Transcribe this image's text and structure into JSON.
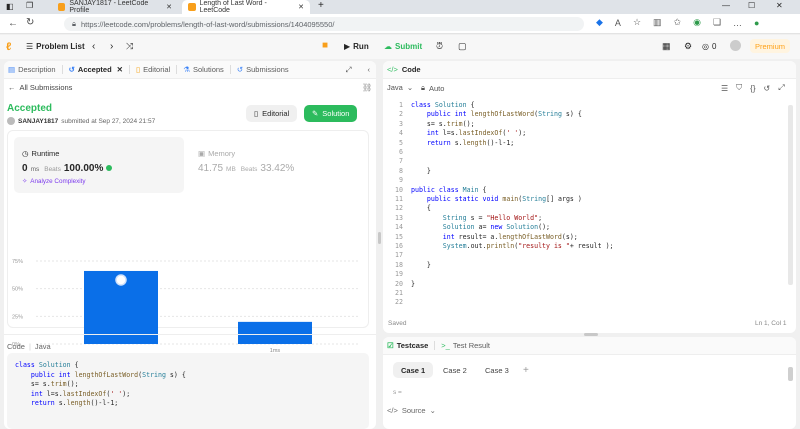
{
  "browser": {
    "tabs": [
      {
        "title": "SANJAY1817 - LeetCode Profile"
      },
      {
        "title": "Length of Last Word - LeetCode"
      }
    ],
    "url": "https://leetcode.com/problems/length-of-last-word/submissions/1404095550/"
  },
  "header": {
    "problem_list": "Problem List",
    "run": "Run",
    "submit": "Submit",
    "coins": "0",
    "premium": "Premium"
  },
  "left": {
    "tabs": [
      "Description",
      "Accepted",
      "Editorial",
      "Solutions",
      "Submissions"
    ],
    "back": "All Submissions",
    "status": "Accepted",
    "user": "SANJAY1817",
    "submitted": "submitted at Sep 27, 2024 21:57",
    "editorial_btn": "Editorial",
    "solution_btn": "Solution",
    "runtime": {
      "label": "Runtime",
      "value": "0",
      "unit": "ms",
      "beats_label": "Beats",
      "beats": "100.00%",
      "analyze": "Analyze Complexity"
    },
    "memory": {
      "label": "Memory",
      "value": "41.75",
      "unit": "MB",
      "beats_label": "Beats",
      "beats": "33.42%"
    },
    "chart_data": {
      "type": "bar",
      "categories": [
        "",
        "1ms"
      ],
      "values": [
        66,
        20
      ],
      "yticks": [
        "75%",
        "50%",
        "25%",
        "0%"
      ],
      "ylim": [
        0,
        75
      ],
      "color": "#0a6fe8",
      "scroll_label": "1ms"
    },
    "code_section": {
      "label": "Code",
      "lang": "Java",
      "lines": [
        "class Solution {",
        "    public int lengthOfLastWord(String s) {",
        "    s= s.trim();",
        "    int l=s.lastIndexOf(' ');",
        "    return s.length()-l-1;"
      ]
    }
  },
  "editor": {
    "title": "Code",
    "lang": "Java",
    "mode": "Auto",
    "status": "Saved",
    "cursor": "Ln 1, Col 1",
    "lines": [
      "class Solution {",
      "    public int lengthOfLastWord(String s) {",
      "    s= s.trim();",
      "    int l=s.lastIndexOf(' ');",
      "    return s.length()-l-1;",
      "",
      "",
      "    }",
      "",
      "public class Main {",
      "    public static void main(String[] args )",
      "    {",
      "        String s = \"Hello World\";",
      "        Solution a= new Solution();",
      "        int result= a.lengthOfLastWord(s);",
      "        System.out.println(\"resulty is \"+ result );",
      "",
      "    }",
      "",
      "}",
      "",
      ""
    ]
  },
  "testcase": {
    "tab": "Testcase",
    "result_tab": "Test Result",
    "cases": [
      "Case 1",
      "Case 2",
      "Case 3"
    ],
    "var": "s =",
    "source": "Source"
  }
}
